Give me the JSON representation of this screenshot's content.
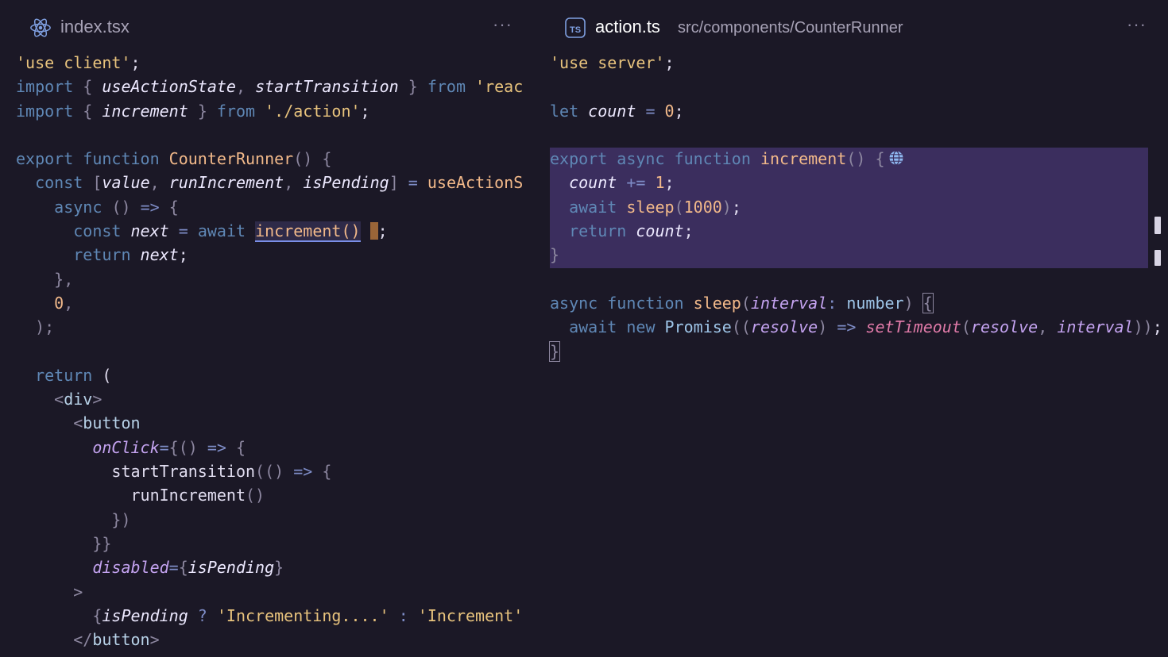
{
  "left": {
    "tab": {
      "icon": "react-icon",
      "name": "index.tsx",
      "more": "···"
    },
    "lines": [
      [
        [
          "s",
          "'use client'"
        ],
        [
          "w",
          ";"
        ]
      ],
      [
        [
          "k",
          "import"
        ],
        [
          "w",
          " "
        ],
        [
          "p",
          "{"
        ],
        [
          "w",
          " "
        ],
        [
          "v",
          "useActionState"
        ],
        [
          "p",
          ","
        ],
        [
          "w",
          " "
        ],
        [
          "v",
          "startTransition"
        ],
        [
          "w",
          " "
        ],
        [
          "p",
          "}"
        ],
        [
          "w",
          " "
        ],
        [
          "k",
          "from"
        ],
        [
          "w",
          " "
        ],
        [
          "s",
          "'reac"
        ]
      ],
      [
        [
          "k",
          "import"
        ],
        [
          "w",
          " "
        ],
        [
          "p",
          "{"
        ],
        [
          "w",
          " "
        ],
        [
          "v",
          "increment"
        ],
        [
          "w",
          " "
        ],
        [
          "p",
          "}"
        ],
        [
          "w",
          " "
        ],
        [
          "k",
          "from"
        ],
        [
          "w",
          " "
        ],
        [
          "s",
          "'./action'"
        ],
        [
          "w",
          ";"
        ]
      ],
      [],
      [
        [
          "k",
          "export"
        ],
        [
          "w",
          " "
        ],
        [
          "k",
          "function"
        ],
        [
          "w",
          " "
        ],
        [
          "fn",
          "CounterRunner"
        ],
        [
          "p",
          "()"
        ],
        [
          "w",
          " "
        ],
        [
          "p",
          "{"
        ]
      ],
      [
        [
          "w",
          "  "
        ],
        [
          "k",
          "const"
        ],
        [
          "w",
          " "
        ],
        [
          "p",
          "["
        ],
        [
          "v",
          "value"
        ],
        [
          "p",
          ","
        ],
        [
          "w",
          " "
        ],
        [
          "v",
          "runIncrement"
        ],
        [
          "p",
          ","
        ],
        [
          "w",
          " "
        ],
        [
          "v",
          "isPending"
        ],
        [
          "p",
          "]"
        ],
        [
          "w",
          " "
        ],
        [
          "o",
          "="
        ],
        [
          "w",
          " "
        ],
        [
          "n",
          "useActionS"
        ]
      ],
      [
        [
          "w",
          "    "
        ],
        [
          "k",
          "async"
        ],
        [
          "w",
          " "
        ],
        [
          "p",
          "()"
        ],
        [
          "w",
          " "
        ],
        [
          "o",
          "=>"
        ],
        [
          "w",
          " "
        ],
        [
          "p",
          "{"
        ]
      ],
      [
        [
          "w",
          "      "
        ],
        [
          "k",
          "const"
        ],
        [
          "w",
          " "
        ],
        [
          "v",
          "next"
        ],
        [
          "w",
          " "
        ],
        [
          "o",
          "="
        ],
        [
          "w",
          " "
        ],
        [
          "k",
          "await"
        ],
        [
          "w",
          " "
        ],
        [
          "ul",
          "increment()"
        ],
        [
          "w",
          " "
        ],
        [
          "cur",
          ""
        ],
        [
          "w",
          ";"
        ]
      ],
      [
        [
          "w",
          "      "
        ],
        [
          "k",
          "return"
        ],
        [
          "w",
          " "
        ],
        [
          "v",
          "next"
        ],
        [
          "w",
          ";"
        ]
      ],
      [
        [
          "w",
          "    "
        ],
        [
          "p",
          "},"
        ]
      ],
      [
        [
          "w",
          "    "
        ],
        [
          "n",
          "0"
        ],
        [
          "p",
          ","
        ]
      ],
      [
        [
          "w",
          "  "
        ],
        [
          "p",
          ");"
        ]
      ],
      [],
      [
        [
          "w",
          "  "
        ],
        [
          "k",
          "return"
        ],
        [
          "w",
          " ("
        ]
      ],
      [
        [
          "w",
          "    "
        ],
        [
          "p",
          "<"
        ],
        [
          "tg",
          "div"
        ],
        [
          "p",
          ">"
        ]
      ],
      [
        [
          "w",
          "      "
        ],
        [
          "p",
          "<"
        ],
        [
          "tg",
          "button"
        ]
      ],
      [
        [
          "w",
          "        "
        ],
        [
          "at",
          "onClick"
        ],
        [
          "o",
          "="
        ],
        [
          "p",
          "{"
        ],
        [
          "p",
          "()"
        ],
        [
          "w",
          " "
        ],
        [
          "o",
          "=>"
        ],
        [
          "w",
          " "
        ],
        [
          "p",
          "{"
        ]
      ],
      [
        [
          "w",
          "          "
        ],
        [
          "w",
          "startTransition"
        ],
        [
          "p",
          "("
        ],
        [
          "p",
          "()"
        ],
        [
          "w",
          " "
        ],
        [
          "o",
          "=>"
        ],
        [
          "w",
          " "
        ],
        [
          "p",
          "{"
        ]
      ],
      [
        [
          "w",
          "            "
        ],
        [
          "w",
          "runIncrement"
        ],
        [
          "p",
          "()"
        ]
      ],
      [
        [
          "w",
          "          "
        ],
        [
          "p",
          "})"
        ]
      ],
      [
        [
          "w",
          "        "
        ],
        [
          "p",
          "}}"
        ]
      ],
      [
        [
          "w",
          "        "
        ],
        [
          "at",
          "disabled"
        ],
        [
          "o",
          "="
        ],
        [
          "p",
          "{"
        ],
        [
          "v",
          "isPending"
        ],
        [
          "p",
          "}"
        ]
      ],
      [
        [
          "w",
          "      "
        ],
        [
          "p",
          ">"
        ]
      ],
      [
        [
          "w",
          "        "
        ],
        [
          "p",
          "{"
        ],
        [
          "v",
          "isPending"
        ],
        [
          "w",
          " "
        ],
        [
          "o",
          "?"
        ],
        [
          "w",
          " "
        ],
        [
          "s",
          "'Incrementing....'"
        ],
        [
          "w",
          " "
        ],
        [
          "o",
          ":"
        ],
        [
          "w",
          " "
        ],
        [
          "s",
          "'Increment'"
        ],
        [
          "p",
          "}"
        ]
      ],
      [
        [
          "w",
          "      "
        ],
        [
          "p",
          "</"
        ],
        [
          "tg",
          "button"
        ],
        [
          "p",
          ">"
        ]
      ]
    ]
  },
  "right": {
    "tab": {
      "icon": "typescript-icon",
      "icon_text": "TS",
      "name": "action.ts",
      "path": "src/components/CounterRunner",
      "more": "···"
    },
    "lines": [
      [
        [
          "s",
          "'use server'"
        ],
        [
          "w",
          ";"
        ]
      ],
      [],
      [
        [
          "k",
          "let"
        ],
        [
          "w",
          " "
        ],
        [
          "v",
          "count"
        ],
        [
          "w",
          " "
        ],
        [
          "o",
          "="
        ],
        [
          "w",
          " "
        ],
        [
          "n",
          "0"
        ],
        [
          "w",
          ";"
        ]
      ],
      [],
      [
        [
          "k",
          "export"
        ],
        [
          "w",
          " "
        ],
        [
          "k",
          "async"
        ],
        [
          "w",
          " "
        ],
        [
          "k",
          "function"
        ],
        [
          "w",
          " "
        ],
        [
          "fn",
          "increment"
        ],
        [
          "p",
          "()"
        ],
        [
          "w",
          " "
        ],
        [
          "p",
          "{"
        ],
        [
          "globe",
          ""
        ]
      ],
      [
        [
          "w",
          "  "
        ],
        [
          "v",
          "count"
        ],
        [
          "w",
          " "
        ],
        [
          "o",
          "+="
        ],
        [
          "w",
          " "
        ],
        [
          "n",
          "1"
        ],
        [
          "w",
          ";"
        ]
      ],
      [
        [
          "w",
          "  "
        ],
        [
          "k",
          "await"
        ],
        [
          "w",
          " "
        ],
        [
          "fn",
          "sleep"
        ],
        [
          "p",
          "("
        ],
        [
          "n",
          "1000"
        ],
        [
          "p",
          ")"
        ],
        [
          "w",
          ";"
        ]
      ],
      [
        [
          "w",
          "  "
        ],
        [
          "k",
          "return"
        ],
        [
          "w",
          " "
        ],
        [
          "v",
          "count"
        ],
        [
          "w",
          ";"
        ]
      ],
      [
        [
          "p",
          "}"
        ]
      ],
      [],
      [
        [
          "k",
          "async"
        ],
        [
          "w",
          " "
        ],
        [
          "k",
          "function"
        ],
        [
          "w",
          " "
        ],
        [
          "fn",
          "sleep"
        ],
        [
          "p",
          "("
        ],
        [
          "at",
          "interval"
        ],
        [
          "o",
          ":"
        ],
        [
          "w",
          " "
        ],
        [
          "t",
          "number"
        ],
        [
          "p",
          ")"
        ],
        [
          "w",
          " "
        ],
        [
          "bb",
          "{"
        ]
      ],
      [
        [
          "w",
          "  "
        ],
        [
          "k",
          "await"
        ],
        [
          "w",
          " "
        ],
        [
          "k",
          "new"
        ],
        [
          "w",
          " "
        ],
        [
          "t",
          "Promise"
        ],
        [
          "p",
          "(("
        ],
        [
          "at",
          "resolve"
        ],
        [
          "p",
          ")"
        ],
        [
          "w",
          " "
        ],
        [
          "o",
          "=>"
        ],
        [
          "w",
          " "
        ],
        [
          "fa",
          "setTimeout"
        ],
        [
          "p",
          "("
        ],
        [
          "at",
          "resolve"
        ],
        [
          "p",
          ","
        ],
        [
          "w",
          " "
        ],
        [
          "at",
          "interval"
        ],
        [
          "p",
          "))"
        ],
        [
          "w",
          ";"
        ]
      ],
      [
        [
          "bb",
          "}"
        ]
      ]
    ]
  }
}
